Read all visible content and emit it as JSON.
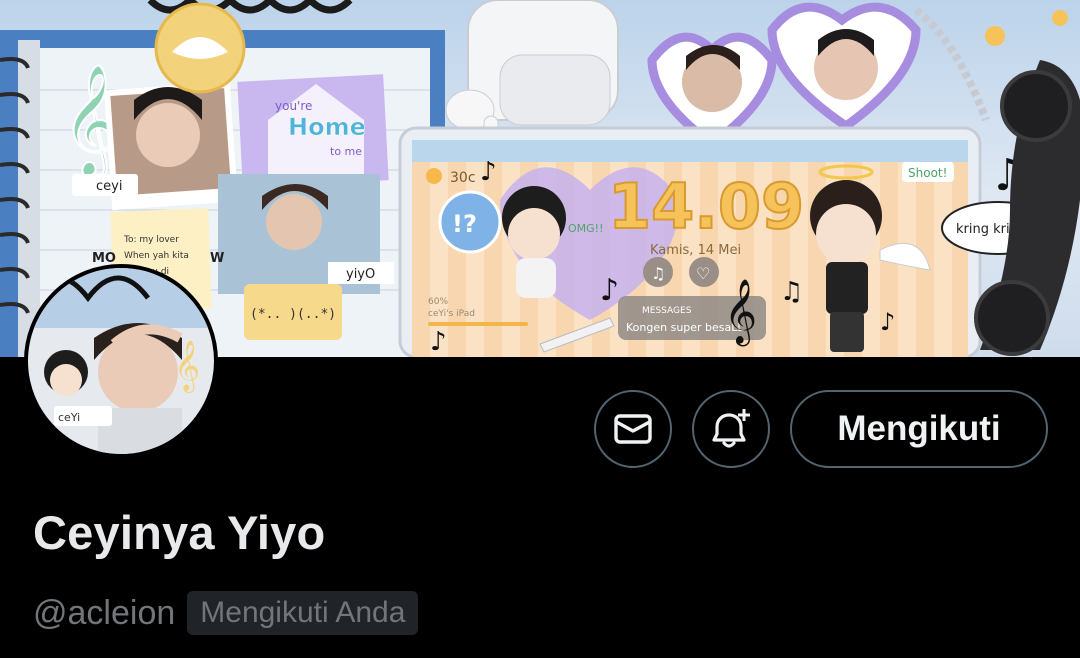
{
  "banner": {
    "clock_time": "14.09",
    "clock_date": "Kamis, 14 Mei",
    "weather_temp": "30c",
    "messages_title": "MESSAGES",
    "messages_preview": "Kongen super besaLL",
    "speech_bubble": "kring kringg?!",
    "sticker_shoot": "Shoot!",
    "sticker_omg": "OMG!!",
    "sticker_exclaim": "!?",
    "home_sticker_top": "you're",
    "home_sticker_main": "Home",
    "home_sticker_bottom": "to me",
    "photo_tag_ceyi": "ceyi",
    "photo_tag_yiyo": "yiyO",
    "note_text": "To: my lover When yah kita ketemu di Monas",
    "kaomoji": "(*.. )(..*)",
    "battery_label": "60%",
    "device_label": "ceYi's iPad",
    "mo_label": "MO",
    "w_label": "W"
  },
  "avatar": {
    "tag": "ceYi"
  },
  "actions": {
    "message_icon": "envelope-icon",
    "notify_icon": "bell-plus-icon",
    "follow_label": "Mengikuti"
  },
  "profile": {
    "display_name": "Ceyinya Yiyo",
    "handle": "@acleion",
    "follows_you": "Mengikuti Anda"
  }
}
